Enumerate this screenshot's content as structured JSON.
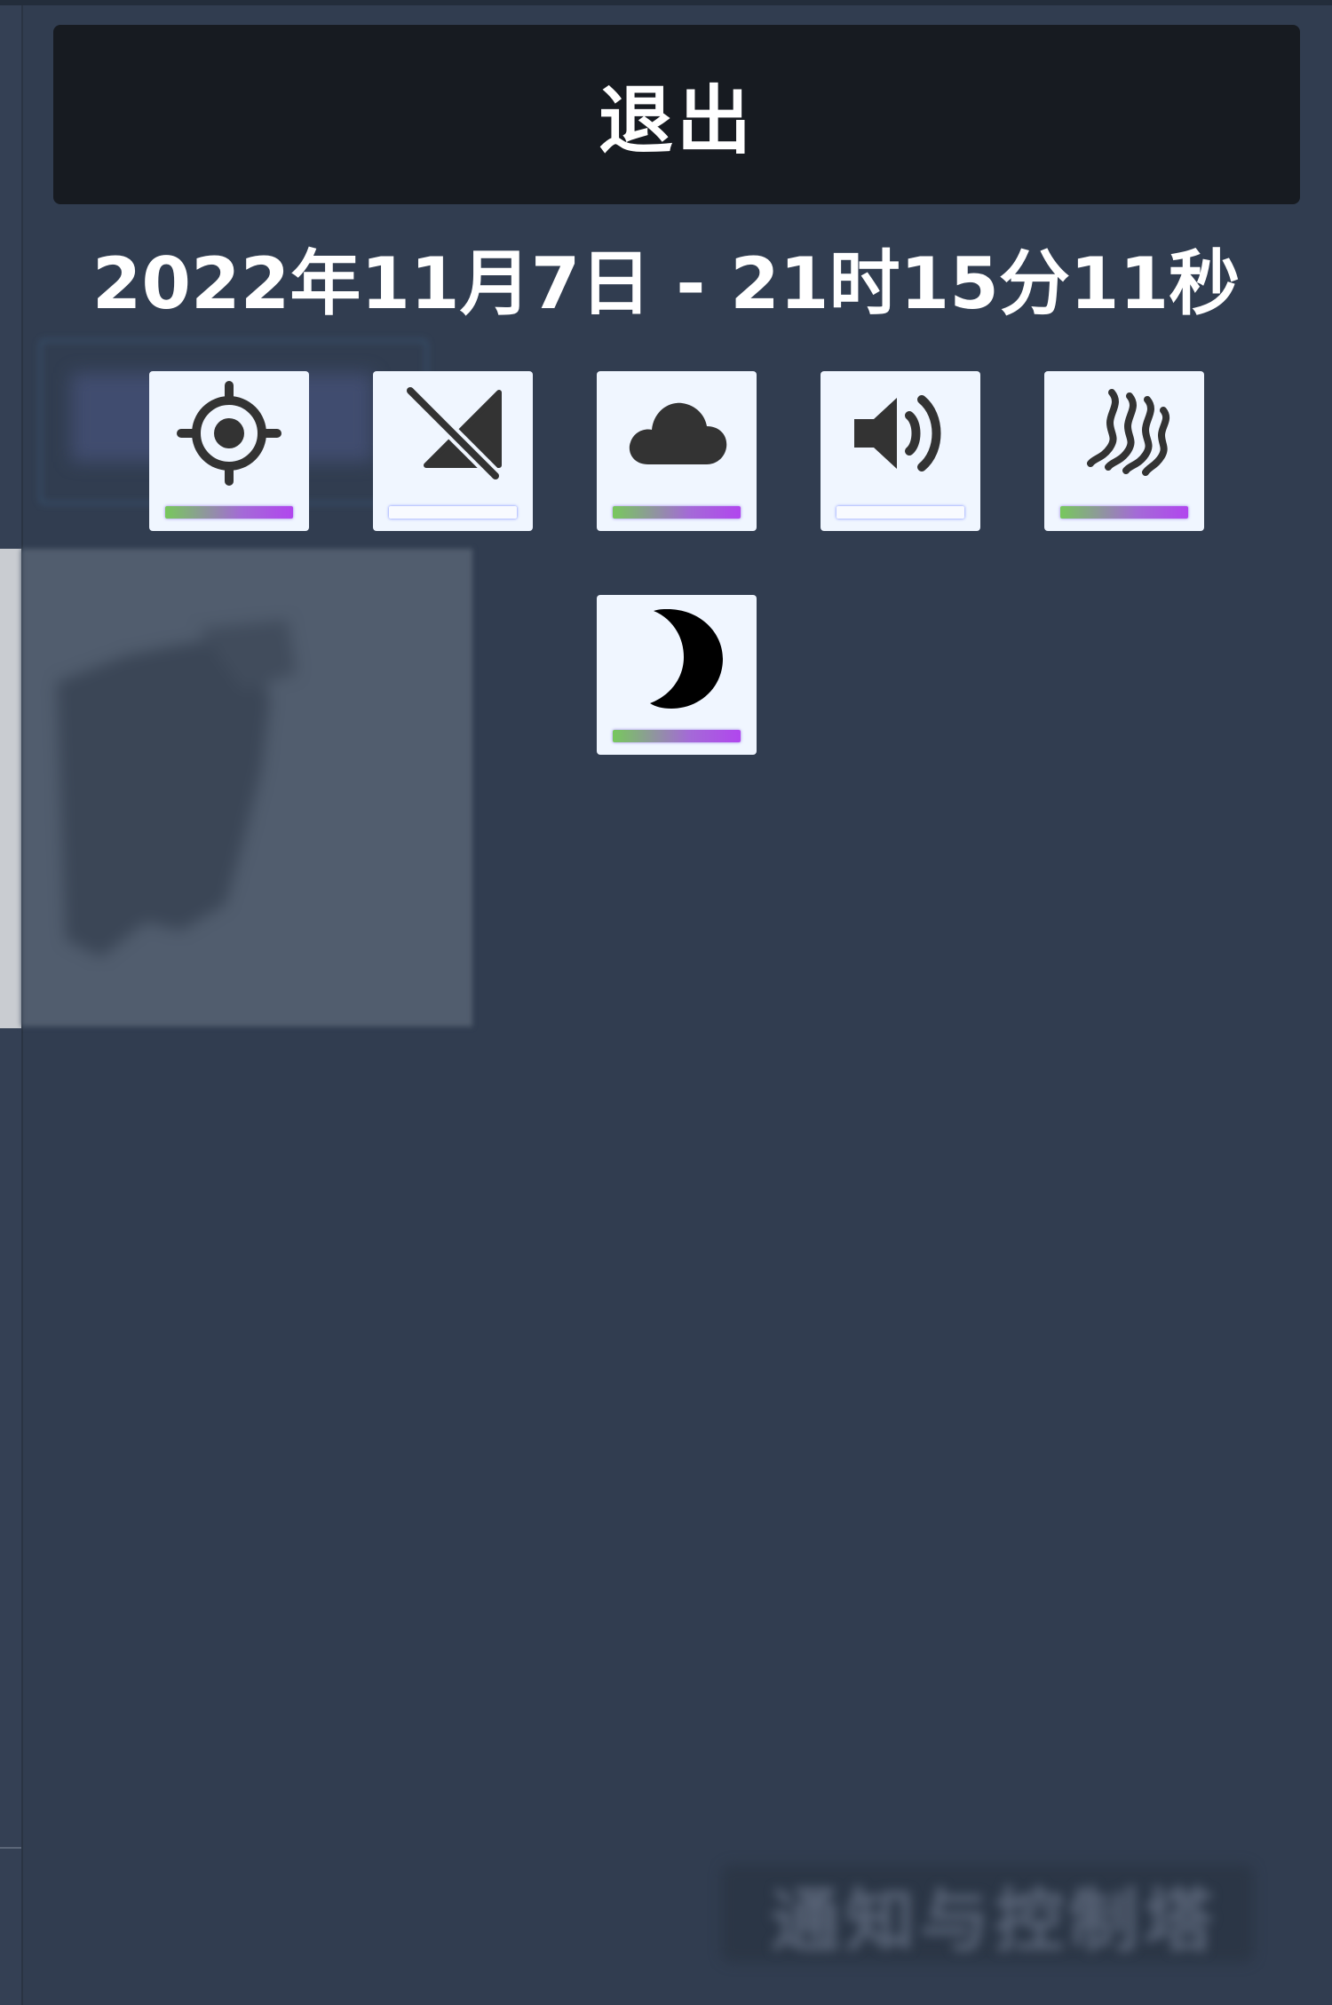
{
  "panel": {
    "exit_label": "退出",
    "datetime": "2022年11月7日 - 21时15分11秒"
  },
  "toggles": [
    {
      "id": "location",
      "icon": "location-crosshair-icon",
      "state": "on"
    },
    {
      "id": "cellular",
      "icon": "cellular-signal-off-icon",
      "state": "off"
    },
    {
      "id": "cloud",
      "icon": "cloud-icon",
      "state": "on"
    },
    {
      "id": "sound",
      "icon": "speaker-volume-icon",
      "state": "off"
    },
    {
      "id": "haptics",
      "icon": "wavy-lines-icon",
      "state": "on"
    },
    {
      "id": "night-mode",
      "icon": "moon-icon",
      "state": "on"
    }
  ],
  "background": {
    "bottom_button_label": "通知与控制塔"
  },
  "colors": {
    "panel_bg": "#2e3a4c",
    "exit_bg": "#171b21",
    "tile_bg": "#f0f6ff",
    "bar_on_start": "#77c85c",
    "bar_on_end": "#b146ee",
    "bar_off": "#f8faff"
  }
}
